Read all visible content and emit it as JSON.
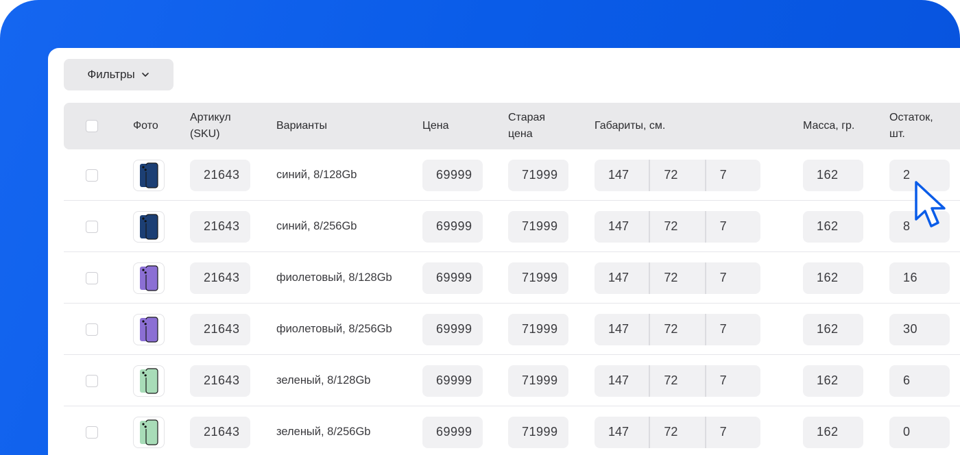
{
  "filters": {
    "label": "Фильтры"
  },
  "columns": {
    "photo": "Фото",
    "sku_line1": "Артикул",
    "sku_line2": "(SKU)",
    "variants": "Варианты",
    "price": "Цена",
    "old_price_line1": "Старая",
    "old_price_line2": "цена",
    "dims": "Габариты, см.",
    "mass": "Масса, гр.",
    "stock_line1": "Остаток,",
    "stock_line2": "шт."
  },
  "rows": [
    {
      "color": "blue",
      "sku": "21643",
      "variant": "синий, 8/128Gb",
      "price": "69999",
      "old_price": "71999",
      "d1": "147",
      "d2": "72",
      "d3": "7",
      "mass": "162",
      "stock": "2"
    },
    {
      "color": "blue",
      "sku": "21643",
      "variant": "синий, 8/256Gb",
      "price": "69999",
      "old_price": "71999",
      "d1": "147",
      "d2": "72",
      "d3": "7",
      "mass": "162",
      "stock": "8"
    },
    {
      "color": "purple",
      "sku": "21643",
      "variant": "фиолетовый, 8/128Gb",
      "price": "69999",
      "old_price": "71999",
      "d1": "147",
      "d2": "72",
      "d3": "7",
      "mass": "162",
      "stock": "16"
    },
    {
      "color": "purple",
      "sku": "21643",
      "variant": "фиолетовый, 8/256Gb",
      "price": "69999",
      "old_price": "71999",
      "d1": "147",
      "d2": "72",
      "d3": "7",
      "mass": "162",
      "stock": "30"
    },
    {
      "color": "green",
      "sku": "21643",
      "variant": "зеленый, 8/128Gb",
      "price": "69999",
      "old_price": "71999",
      "d1": "147",
      "d2": "72",
      "d3": "7",
      "mass": "162",
      "stock": "6"
    },
    {
      "color": "green",
      "sku": "21643",
      "variant": "зеленый, 8/256Gb",
      "price": "69999",
      "old_price": "71999",
      "d1": "147",
      "d2": "72",
      "d3": "7",
      "mass": "162",
      "stock": "0"
    }
  ],
  "phone_colors": {
    "blue": "#1c3f74",
    "purple": "#8b6fd4",
    "green": "#a8dcb8"
  },
  "accent": "#0a5ce8"
}
